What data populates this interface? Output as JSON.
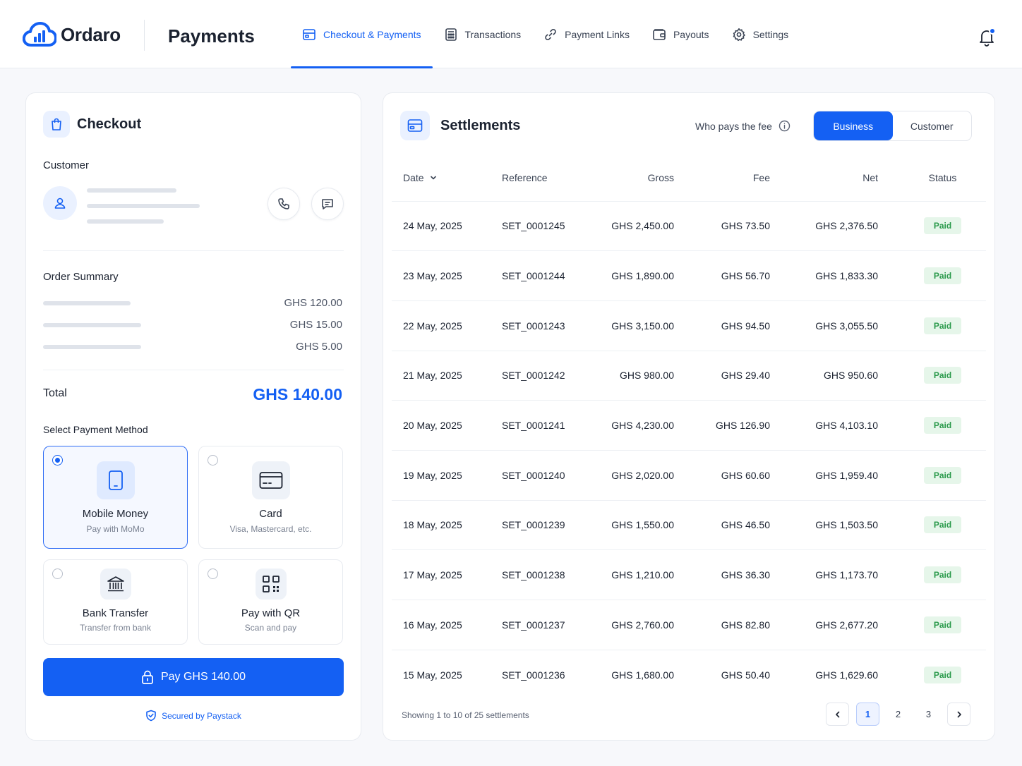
{
  "brand": {
    "name": "Ordaro",
    "app_title": "Payments",
    "accent": "#1460f3"
  },
  "nav": {
    "items": [
      {
        "label": "Checkout & Payments",
        "icon": "checkout-icon",
        "active": true
      },
      {
        "label": "Transactions",
        "icon": "calculator-icon",
        "active": false
      },
      {
        "label": "Payment Links",
        "icon": "link-icon",
        "active": false
      },
      {
        "label": "Payouts",
        "icon": "wallet-icon",
        "active": false
      },
      {
        "label": "Settings",
        "icon": "gear-icon",
        "active": false
      }
    ],
    "notification_icon": "bell-icon"
  },
  "checkout": {
    "title": "Checkout",
    "customer_label": "Customer",
    "order_summary_label": "Order Summary",
    "line_amounts": [
      "GHS 120.00",
      "GHS 15.00",
      "GHS 5.00"
    ],
    "total_label": "Total",
    "total_value": "GHS 140.00",
    "payment_method_label": "Select Payment Method",
    "methods": [
      {
        "title": "Mobile Money",
        "subtitle": "Pay with MoMo",
        "icon": "phone-icon",
        "selected": true
      },
      {
        "title": "Card",
        "subtitle": "Visa, Mastercard, etc.",
        "icon": "card-icon",
        "selected": false
      },
      {
        "title": "Bank Transfer",
        "subtitle": "Transfer from bank",
        "icon": "bank-icon",
        "selected": false
      },
      {
        "title": "Pay with QR",
        "subtitle": "Scan and pay",
        "icon": "qr-icon",
        "selected": false
      }
    ],
    "pay_button": "Pay GHS 140.00",
    "secured_text": "Secured by Paystack"
  },
  "settlements": {
    "title": "Settlements",
    "fee_label": "Who pays the fee",
    "fee_options": [
      "Business",
      "Customer"
    ],
    "fee_selected": "Business",
    "columns": [
      "Date",
      "Reference",
      "Gross",
      "Fee",
      "Net",
      "Status"
    ],
    "rows": [
      {
        "date": "24 May, 2025",
        "ref": "SET_0001245",
        "gross": "GHS 2,450.00",
        "fee": "GHS 73.50",
        "net": "GHS 2,376.50",
        "status": "Paid"
      },
      {
        "date": "23 May, 2025",
        "ref": "SET_0001244",
        "gross": "GHS 1,890.00",
        "fee": "GHS 56.70",
        "net": "GHS 1,833.30",
        "status": "Paid"
      },
      {
        "date": "22 May, 2025",
        "ref": "SET_0001243",
        "gross": "GHS 3,150.00",
        "fee": "GHS 94.50",
        "net": "GHS 3,055.50",
        "status": "Paid"
      },
      {
        "date": "21 May, 2025",
        "ref": "SET_0001242",
        "gross": "GHS 980.00",
        "fee": "GHS 29.40",
        "net": "GHS 950.60",
        "status": "Paid"
      },
      {
        "date": "20 May, 2025",
        "ref": "SET_0001241",
        "gross": "GHS 4,230.00",
        "fee": "GHS 126.90",
        "net": "GHS 4,103.10",
        "status": "Paid"
      },
      {
        "date": "19 May, 2025",
        "ref": "SET_0001240",
        "gross": "GHS 2,020.00",
        "fee": "GHS 60.60",
        "net": "GHS 1,959.40",
        "status": "Paid"
      },
      {
        "date": "18 May, 2025",
        "ref": "SET_0001239",
        "gross": "GHS 1,550.00",
        "fee": "GHS 46.50",
        "net": "GHS 1,503.50",
        "status": "Paid"
      },
      {
        "date": "17 May, 2025",
        "ref": "SET_0001238",
        "gross": "GHS 1,210.00",
        "fee": "GHS 36.30",
        "net": "GHS 1,173.70",
        "status": "Paid"
      },
      {
        "date": "16 May, 2025",
        "ref": "SET_0001237",
        "gross": "GHS 2,760.00",
        "fee": "GHS 82.80",
        "net": "GHS 2,677.20",
        "status": "Paid"
      },
      {
        "date": "15 May, 2025",
        "ref": "SET_0001236",
        "gross": "GHS 1,680.00",
        "fee": "GHS 50.40",
        "net": "GHS 1,629.60",
        "status": "Paid"
      }
    ],
    "showing_text": "Showing 1 to 10 of 25 settlements",
    "pages": [
      "1",
      "2",
      "3"
    ],
    "current_page": "1",
    "status_colors": {
      "paid_bg": "#e6f6ea",
      "paid_text": "#2a9a4b"
    }
  }
}
